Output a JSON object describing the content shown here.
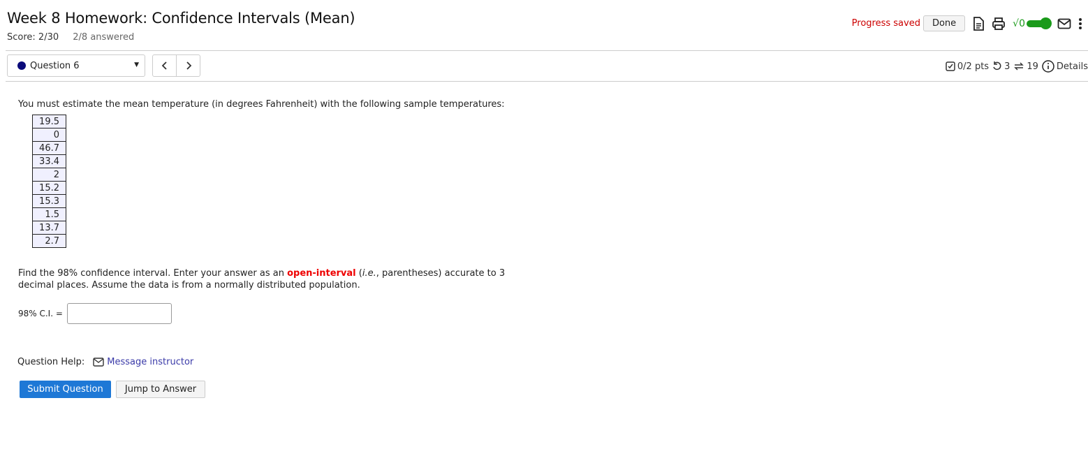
{
  "header": {
    "title": "Week 8 Homework: Confidence Intervals (Mean)",
    "score": "Score: 2/30",
    "answered": "2/8 answered",
    "progress_status": "Progress saved",
    "done_label": "Done",
    "sqrt_label": "√0",
    "colors": {
      "progress": "#cc0000",
      "toggle": "#1a9a1a"
    }
  },
  "question_nav": {
    "selected": "Question 6",
    "prev_glyph": "<",
    "next_glyph": ">"
  },
  "meta": {
    "points": "0/2 pts",
    "retries": "3",
    "attempts": "19",
    "details_label": "Details"
  },
  "question": {
    "prompt": "You must estimate the mean temperature (in degrees Fahrenheit) with the following sample temperatures:",
    "samples": [
      "19.5",
      "0",
      "46.7",
      "33.4",
      "2",
      "15.2",
      "15.3",
      "1.5",
      "13.7",
      "2.7"
    ],
    "find_part1": "Find the 98% confidence interval. Enter your answer as an ",
    "find_highlight": "open-interval",
    "find_paren_open": " (",
    "find_italic": "i.e.",
    "find_part2": ", parentheses) accurate to 3 decimal places. Assume the data is from a normally distributed population.",
    "ci_label": "98% C.I. =",
    "ci_value": ""
  },
  "help": {
    "label": "Question Help:",
    "message_link": "Message instructor"
  },
  "actions": {
    "submit_label": "Submit Question",
    "jump_label": "Jump to Answer"
  }
}
